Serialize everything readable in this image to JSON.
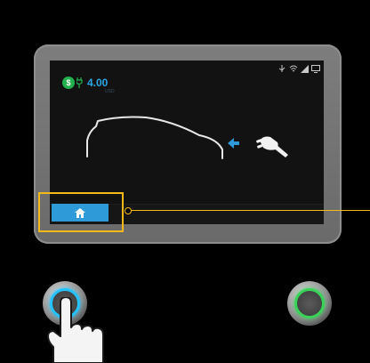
{
  "screen": {
    "balance": {
      "currency_icon": "dollar-coin-icon",
      "coin_symbol": "$",
      "amount": "4.00",
      "unit": "USD"
    },
    "status_icons": [
      "usb-icon",
      "wifi-icon",
      "signal-icon",
      "monitor-icon"
    ],
    "illustration": {
      "vehicle": "car-outline-icon",
      "direction": "arrow-left-icon",
      "connector": "charging-plug-icon"
    },
    "home_button": {
      "icon": "home-icon"
    }
  },
  "colors": {
    "accent_blue": "#2f9ad8",
    "amount_blue": "#2aa7e6",
    "coin_green": "#23b14d",
    "highlight_yellow": "#f7b81a",
    "ring_blue": "#22c3ff",
    "ring_green": "#39d35a"
  },
  "hardware": {
    "left_button": "blue-ring-button",
    "right_button": "green-ring-button",
    "pointer": "hand-pointer-icon"
  }
}
